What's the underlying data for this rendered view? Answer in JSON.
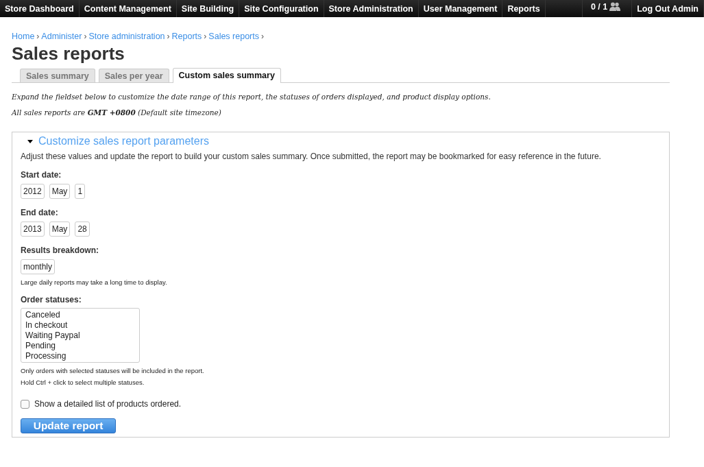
{
  "toolbar": {
    "items": [
      {
        "label": "Store Dashboard"
      },
      {
        "label": "Content Management"
      },
      {
        "label": "Site Building"
      },
      {
        "label": "Site Configuration"
      },
      {
        "label": "Store Administration"
      },
      {
        "label": "User Management"
      },
      {
        "label": "Reports"
      }
    ],
    "users_count": "0 / 1",
    "logout": "Log Out Admin"
  },
  "breadcrumb": [
    "Home",
    "Administer",
    "Store administration",
    "Reports",
    "Sales reports"
  ],
  "breadcrumb_separator": "›",
  "title": "Sales reports",
  "tabs": [
    {
      "label": "Sales summary",
      "selected": false
    },
    {
      "label": "Sales per year",
      "selected": false
    },
    {
      "label": "Custom sales summary",
      "selected": true
    }
  ],
  "intro": [
    "Expand the fieldset below to customize the date range of this report, the statuses of orders displayed, and product display options.",
    "All sales reports are **GMT +0800** (Default site timezone)"
  ],
  "fieldset": {
    "legend": "Customize sales report parameters",
    "expanded": true,
    "description": "Adjust these values and update the report to build your custom sales summary. Once submitted, the report may be bookmarked for easy reference in the future.",
    "start_date": {
      "label": "Start date:",
      "year": "2012",
      "month": "May",
      "day": "1"
    },
    "end_date": {
      "label": "End date:",
      "year": "2013",
      "month": "May",
      "day": "28"
    },
    "breakdown": {
      "label": "Results breakdown:",
      "value": "monthly",
      "help": "Large daily reports may take a long time to display."
    },
    "statuses": {
      "label": "Order statuses:",
      "options": [
        {
          "label": "Canceled",
          "selected": false
        },
        {
          "label": "In checkout",
          "selected": false
        },
        {
          "label": "Waiting Paypal",
          "selected": false
        },
        {
          "label": "Pending",
          "selected": false
        },
        {
          "label": "Processing",
          "selected": false
        }
      ],
      "help": [
        "Only orders with selected statuses will be included in the report.",
        "Hold Ctrl + click to select multiple statuses."
      ]
    },
    "detailed_list": {
      "label": "Show a detailed list of products ordered.",
      "checked": false
    },
    "submit": "Update report"
  }
}
